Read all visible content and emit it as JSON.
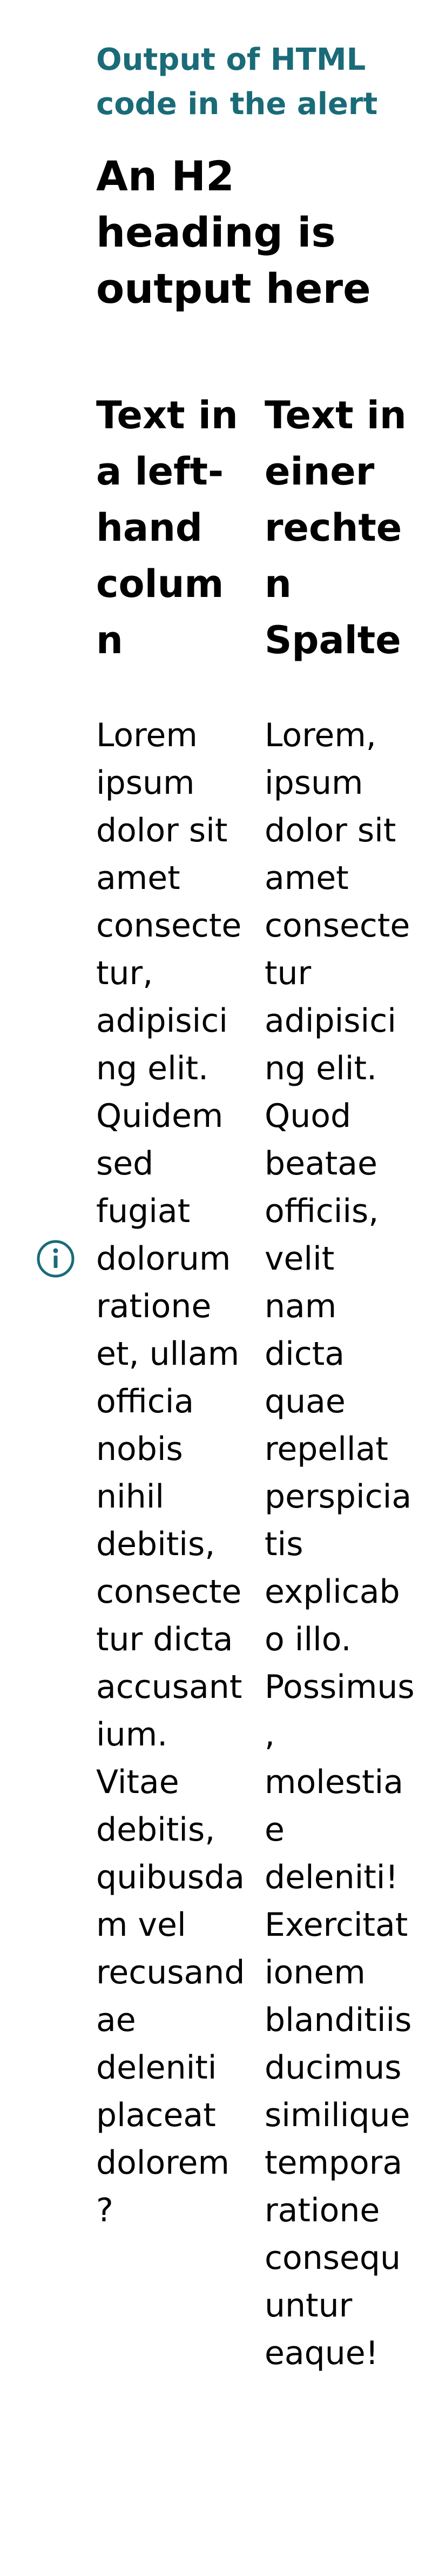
{
  "alert": {
    "title": "Output of HTML code in the alert",
    "icon": "info-icon",
    "accent_color": "#1a6b78",
    "heading": "An H2 heading is output here",
    "columns": [
      {
        "heading": "Text in a left-hand column",
        "text": "Lorem ipsum dolor sit amet consectetur, adipisicing elit. Quidem sed fugiat dolorum ratione et, ullam officia nobis nihil debitis, consectetur dicta accusantium. Vitae debitis, quibusdam vel recusandae deleniti placeat dolorem?"
      },
      {
        "heading": "Text in einer rechten Spalte",
        "text": "Lorem, ipsum dolor sit amet consectetur adipisicing elit. Quod beatae officiis, velit nam dicta quae repellat perspiciatis explicabo illo. Possimus, molestiae deleniti! Exercitationem blanditiis ducimus similique tempora ratione consequuntur eaque!"
      }
    ]
  }
}
